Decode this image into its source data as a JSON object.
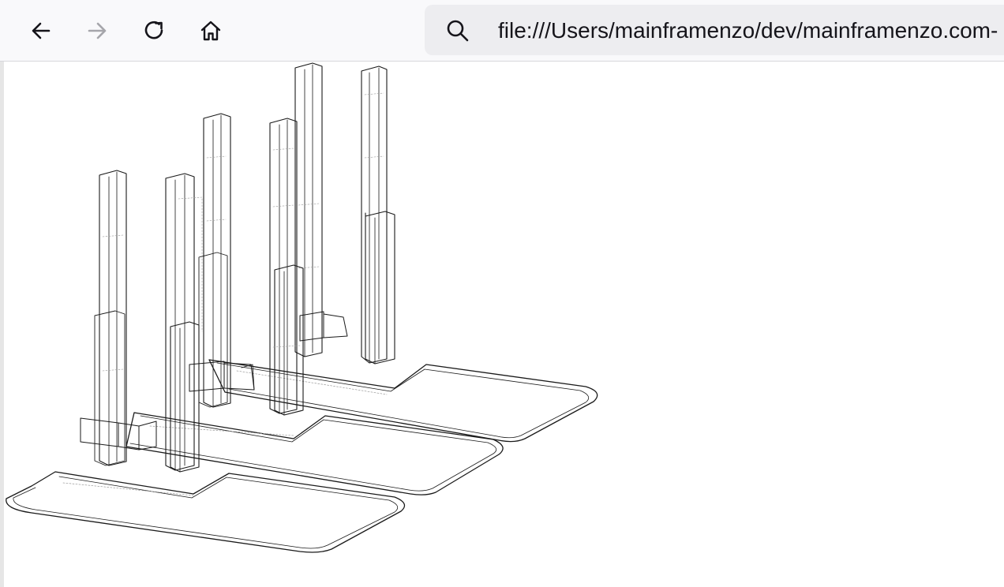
{
  "toolbar": {
    "back_icon": "arrow-left-icon",
    "forward_icon": "arrow-right-icon",
    "reload_icon": "reload-icon",
    "home_icon": "home-icon"
  },
  "urlbar": {
    "search_icon": "search-icon",
    "url": "file:///Users/mainframenzo/dev/mainframenzo.com-"
  },
  "content": {
    "description_icon": "isometric-wireframe-drawing",
    "colors": {
      "stroke": "#1a1a1a",
      "hidden_line": "#9a9a9a",
      "toolbar_bg": "#f9f9fb",
      "urlbar_bg": "#ededf0"
    }
  }
}
